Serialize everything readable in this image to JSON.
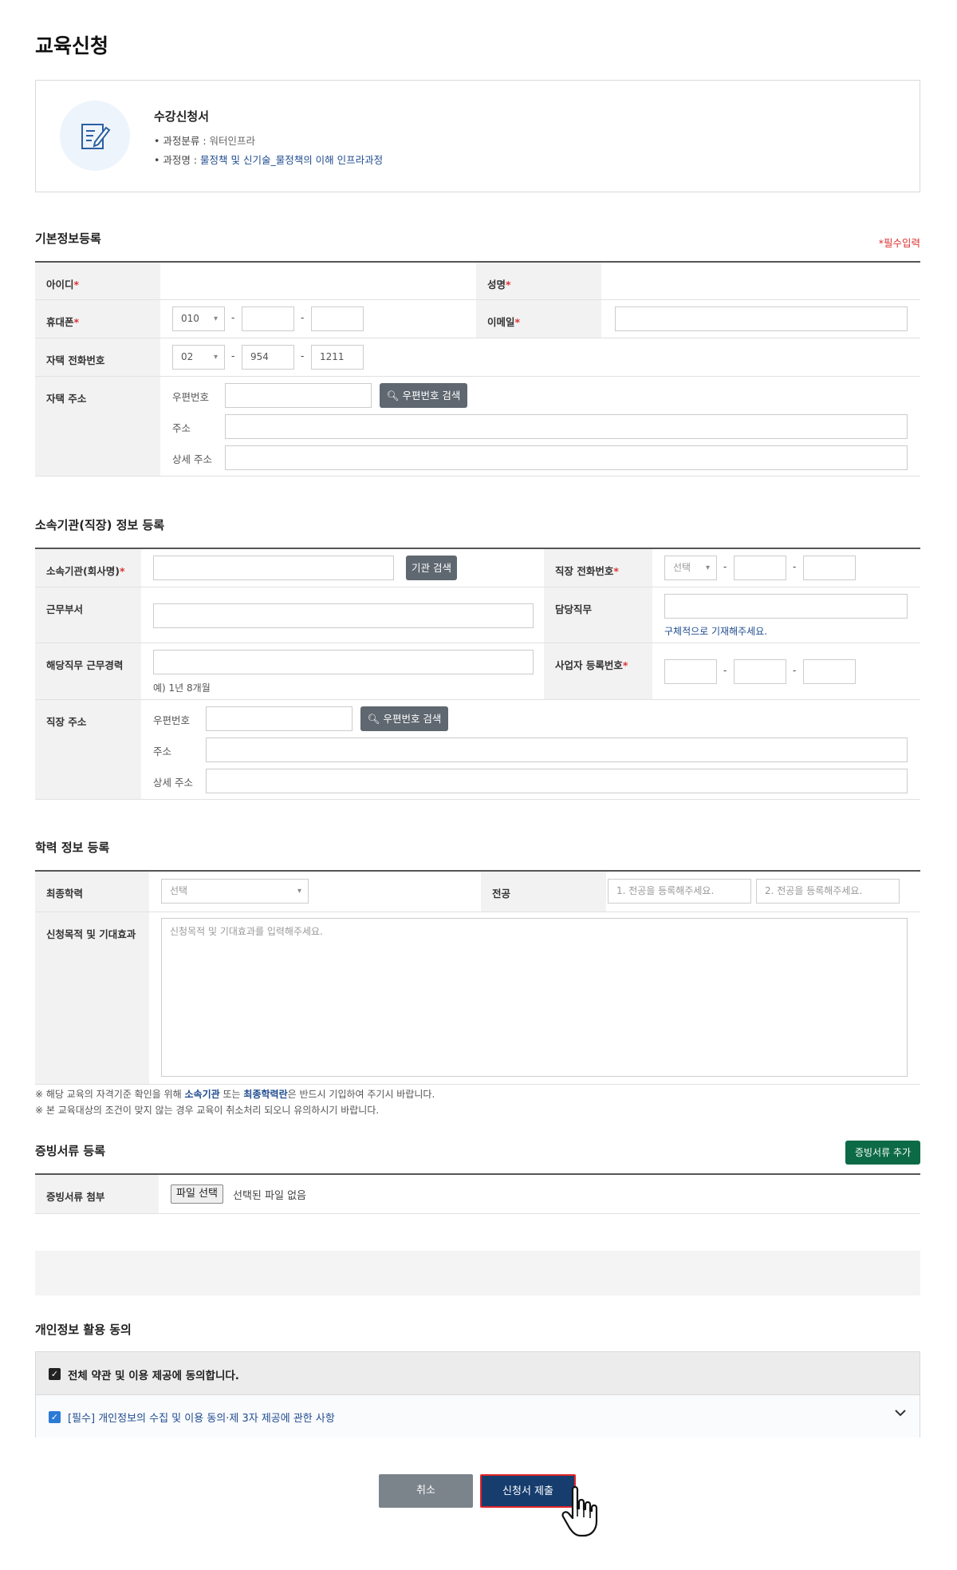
{
  "page_title": "교육신청",
  "course": {
    "title": "수강신청서",
    "category_label": "• 과정분류 : ",
    "category_value": "워터인프라",
    "name_label": "• 과정명 : ",
    "name_value": "물정책 및 신기술_물정책의 이해 인프라과정"
  },
  "basic": {
    "title": "기본정보등록",
    "required_note": "*필수입력",
    "id_label": "아이디",
    "name_label": "성명",
    "mobile_label": "휴대폰",
    "mobile_prefix": "010",
    "email_label": "이메일",
    "home_phone_label": "자택 전화번호",
    "home_phone_prefix": "02",
    "home_phone_mid": "954",
    "home_phone_last": "1211",
    "home_address_label": "자택 주소",
    "zipcode_label": "우편번호",
    "zip_search_label": "우편번호 검색",
    "address_label": "주소",
    "detail_address_label": "상세 주소"
  },
  "org": {
    "title": "소속기관(직장) 정보 등록",
    "org_label": "소속기관(회사명)",
    "org_search_label": "기관 검색",
    "work_phone_label": "직장 전화번호",
    "work_phone_select": "선택",
    "dept_label": "근무부서",
    "duty_label": "담당직무",
    "duty_hint": "구체적으로 기재해주세요.",
    "career_label": "해당직무 근무경력",
    "career_hint": "예) 1년 8개월",
    "biz_no_label": "사업자 등록번호",
    "work_address_label": "직장 주소",
    "zipcode_label": "우편번호",
    "zip_search_label": "우편번호 검색",
    "address_label": "주소",
    "detail_address_label": "상세 주소"
  },
  "edu": {
    "title": "학력 정보 등록",
    "final_edu_label": "최종학력",
    "final_edu_select": "선택",
    "major_label": "전공",
    "major1_placeholder": "1. 전공을 등록해주세요.",
    "major2_placeholder": "2. 전공을 등록해주세요.",
    "purpose_label": "신청목적 및 기대효과",
    "purpose_placeholder": "신청목적 및 기대효과를 입력해주세요."
  },
  "notes": {
    "line1_a": "※ 해당 교육의 자격기준 확인을 위해 ",
    "line1_hl1": "소속기관",
    "line1_b": " 또는 ",
    "line1_hl2": "최종학력란",
    "line1_c": "은 반드시 기입하여 주기시 바랍니다.",
    "line2": "※ 본 교육대상의 조건이 맞지 않는 경우 교육이 취소처리 되오니 유의하시기 바랍니다."
  },
  "docs": {
    "title": "증빙서류 등록",
    "add_label": "증빙서류 추가",
    "attach_label": "증빙서류 첨부",
    "file_button": "파일 선택",
    "file_status": "선택된 파일 없음"
  },
  "privacy": {
    "title": "개인정보 활용 동의",
    "agree_all": "전체 약관 및 이용 제공에 동의합니다.",
    "agree_item": "[필수] 개인정보의 수집 및 이용 동의·제 3자 제공에 관한 사항"
  },
  "actions": {
    "cancel": "취소",
    "submit": "신청서 제출"
  }
}
